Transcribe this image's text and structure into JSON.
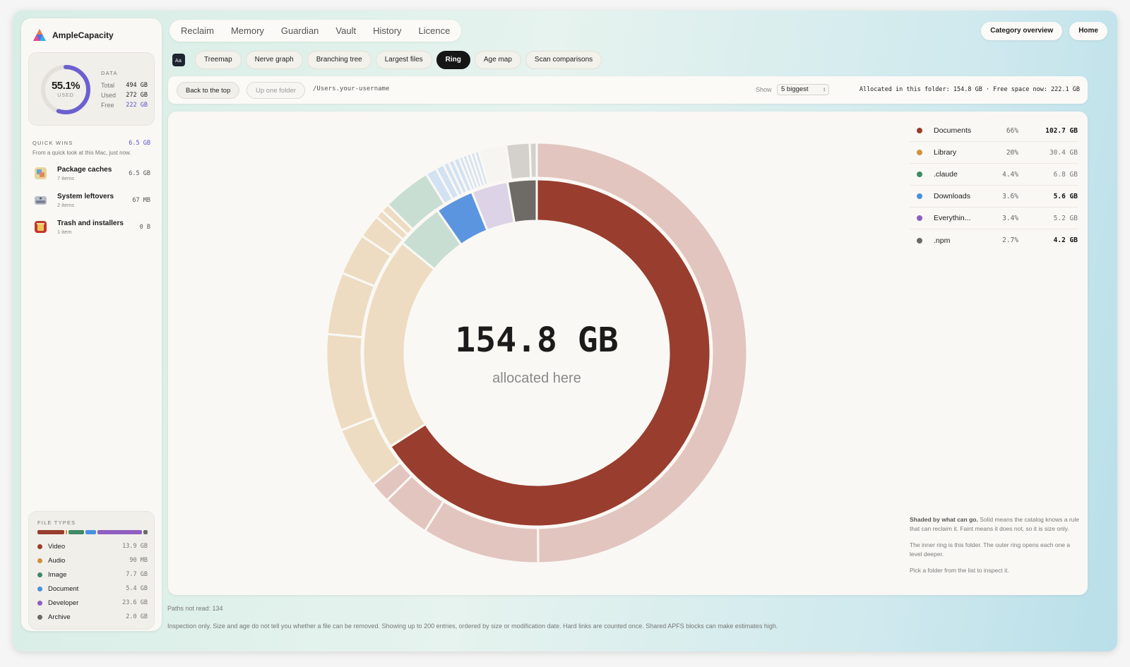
{
  "app": {
    "name": "AmpleCapacity"
  },
  "disk": {
    "used_pct": "55.1%",
    "used_pct_value": 0.551,
    "used_label": "USED",
    "data_head": "DATA",
    "rows": [
      {
        "k": "Total",
        "v": "494 GB"
      },
      {
        "k": "Used",
        "v": "272 GB"
      },
      {
        "k": "Free",
        "v": "222 GB"
      }
    ]
  },
  "quick_wins": {
    "title": "QUICK WINS",
    "total": "6.5 GB",
    "subtitle": "From a quick look at this Mac, just now.",
    "items": [
      {
        "title": "Package caches",
        "count": "7 items",
        "size": "6.5 GB",
        "icon": "package-icon"
      },
      {
        "title": "System leftovers",
        "count": "2 items",
        "size": "67 MB",
        "icon": "drive-icon"
      },
      {
        "title": "Trash and installers",
        "count": "1 item",
        "size": "0 B",
        "icon": "trash-icon"
      }
    ]
  },
  "file_types": {
    "title": "FILE TYPES",
    "rows": [
      {
        "name": "Video",
        "size": "13.9 GB",
        "color": "#993d2e",
        "share": 0.26
      },
      {
        "name": "Audio",
        "size": "90 MB",
        "color": "#d1913a",
        "share": 0.01
      },
      {
        "name": "Image",
        "size": "7.7 GB",
        "color": "#3f8a66",
        "share": 0.15
      },
      {
        "name": "Document",
        "size": "5.4 GB",
        "color": "#4a90e2",
        "share": 0.1
      },
      {
        "name": "Developer",
        "size": "23.6 GB",
        "color": "#8e5fc0",
        "share": 0.44
      },
      {
        "name": "Archive",
        "size": "2.0 GB",
        "color": "#6a6a68",
        "share": 0.04
      }
    ]
  },
  "nav": {
    "tabs": [
      "Reclaim",
      "Memory",
      "Guardian",
      "Vault",
      "History",
      "Licence"
    ],
    "category_overview": "Category overview",
    "home": "Home"
  },
  "views": {
    "items": [
      "Treemap",
      "Nerve graph",
      "Branching tree",
      "Largest files",
      "Ring",
      "Age map",
      "Scan comparisons"
    ],
    "active": "Ring"
  },
  "pathbar": {
    "back_to_top": "Back to the top",
    "up_one": "Up one folder",
    "path": "/Users.your-username",
    "show_label": "Show",
    "show_value": "5 biggest",
    "info": "Allocated in this folder: 154.8 GB · Free space now: 222.1 GB"
  },
  "center": {
    "value": "154.8 GB",
    "sub": "allocated here"
  },
  "legend": [
    {
      "name": "Documents",
      "pct": "66%",
      "size": "102.7 GB",
      "color": "#993d2e",
      "bold": true
    },
    {
      "name": "Library",
      "pct": "20%",
      "size": "30.4 GB",
      "color": "#d1913a",
      "bold": false
    },
    {
      "name": ".claude",
      "pct": "4.4%",
      "size": "6.8 GB",
      "color": "#3f8a66",
      "bold": false
    },
    {
      "name": "Downloads",
      "pct": "3.6%",
      "size": "5.6 GB",
      "color": "#4a90e2",
      "bold": true
    },
    {
      "name": "Everythin...",
      "pct": "3.4%",
      "size": "5.2 GB",
      "color": "#8e5fc0",
      "bold": false
    },
    {
      "name": ".npm",
      "pct": "2.7%",
      "size": "4.2 GB",
      "color": "#6a6a68",
      "bold": true
    }
  ],
  "ring": {
    "inner": [
      {
        "name": "Documents",
        "share": 0.66,
        "color": "#993d2e"
      },
      {
        "name": "Library",
        "share": 0.2,
        "color": "#eddcc2"
      },
      {
        "name": ".claude",
        "share": 0.044,
        "color": "#c9ded2"
      },
      {
        "name": "Downloads",
        "share": 0.036,
        "color": "#5b95e0"
      },
      {
        "name": "Everything else",
        "share": 0.034,
        "color": "#dcd3e6"
      },
      {
        "name": ".npm",
        "share": 0.027,
        "color": "#6e6a65"
      }
    ],
    "outer": [
      {
        "share": 0.47,
        "color": "#e2c5bf"
      },
      {
        "share": 0.085,
        "color": "#e2c5bf"
      },
      {
        "share": 0.035,
        "color": "#e2c5bf"
      },
      {
        "share": 0.015,
        "color": "#e2c5bf"
      },
      {
        "share": 0.045,
        "color": "#eddcc2"
      },
      {
        "share": 0.07,
        "color": "#eddcc2"
      },
      {
        "share": 0.045,
        "color": "#eddcc2"
      },
      {
        "share": 0.03,
        "color": "#eddcc2"
      },
      {
        "share": 0.017,
        "color": "#eddcc2"
      },
      {
        "share": 0.006,
        "color": "#eddcc2"
      },
      {
        "share": 0.006,
        "color": "#eddcc2"
      },
      {
        "share": 0.035,
        "color": "#c9ded2"
      },
      {
        "share": 0.008,
        "color": "#d3e2f2"
      },
      {
        "share": 0.006,
        "color": "#d3e2f2"
      },
      {
        "share": 0.004,
        "color": "#d3e2f2"
      },
      {
        "share": 0.004,
        "color": "#d3e2f2"
      },
      {
        "share": 0.004,
        "color": "#d3e2f2"
      },
      {
        "share": 0.003,
        "color": "#d3e2f2"
      },
      {
        "share": 0.003,
        "color": "#d3e2f2"
      },
      {
        "share": 0.003,
        "color": "#d3e2f2"
      },
      {
        "share": 0.003,
        "color": "#d3e2f2"
      },
      {
        "share": 0.003,
        "color": "#d3e2f2"
      },
      {
        "share": 0.02,
        "color": "#f7f5f1"
      },
      {
        "share": 0.017,
        "color": "#d4d1cc"
      },
      {
        "share": 0.005,
        "color": "#d4d1cc"
      }
    ]
  },
  "notes": {
    "p1_bold": "Shaded by what can go.",
    "p1_rest": " Solid means the catalog knows a rule that can reclaim it. Faint means it does not, so it is size only.",
    "p2": "The inner ring is this folder. The outer ring opens each one a level deeper.",
    "p3": "Pick a folder from the list to inspect it."
  },
  "footer": {
    "paths_not_read": "Paths not read: 134",
    "disclaimer": "Inspection only. Size and age do not tell you whether a file can be removed. Showing up to 200 entries, ordered by size or modification date. Hard links are counted once. Shared APFS blocks can make estimates high."
  }
}
